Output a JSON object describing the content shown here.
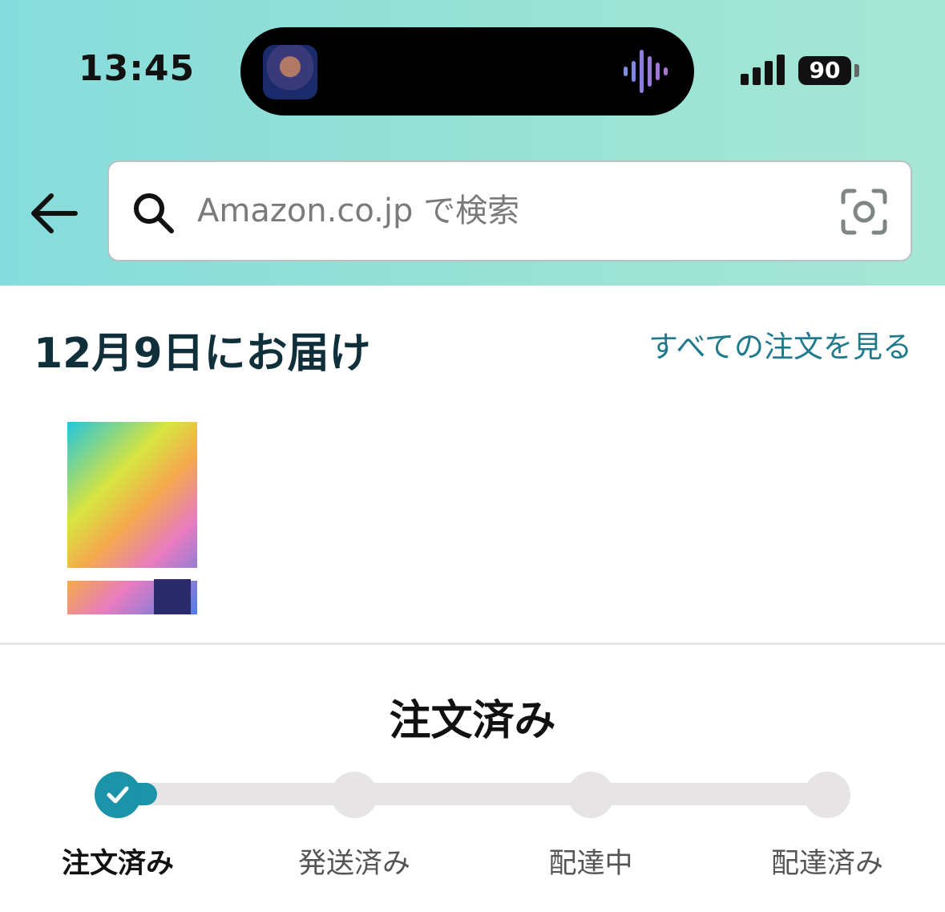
{
  "status_bar": {
    "time": "13:45",
    "battery": "90"
  },
  "search": {
    "placeholder": "Amazon.co.jp で検索"
  },
  "delivery": {
    "heading": "12月9日にお届け",
    "view_all_link": "すべての注文を見る"
  },
  "order": {
    "status_title": "注文済み",
    "progress_step": 1
  },
  "tracker": {
    "steps": [
      {
        "label": "注文済み",
        "done": true
      },
      {
        "label": "発送済み",
        "done": false
      },
      {
        "label": "配達中",
        "done": false
      },
      {
        "label": "配達済み",
        "done": false
      }
    ]
  },
  "colors": {
    "accent": "#1b93a8",
    "link": "#1f7a8c",
    "header_start": "#86dcdc",
    "header_end": "#a6e6d4"
  },
  "icons": [
    "back-arrow-icon",
    "search-icon",
    "camera-scan-icon",
    "audio-wave-icon",
    "signal-icon",
    "checkmark-icon"
  ]
}
